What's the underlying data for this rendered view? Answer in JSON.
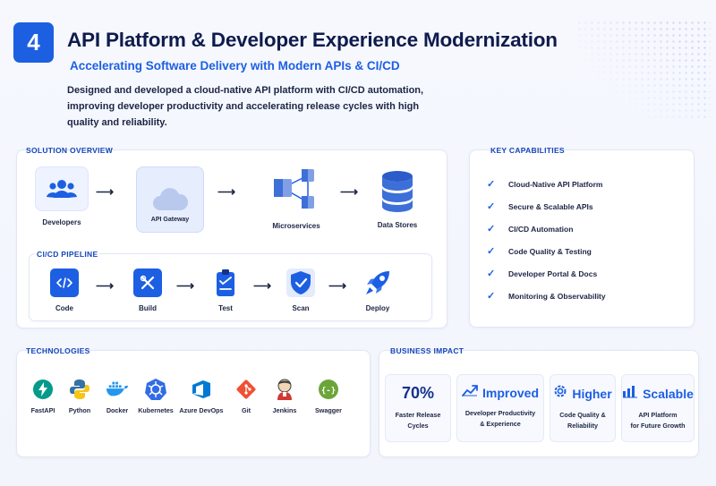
{
  "header": {
    "badge_number": "4",
    "title": "API Platform & Developer Experience Modernization",
    "subtitle": "Accelerating Software Delivery with Modern APIs & CI/CD",
    "description": "Designed and developed a cloud-native API platform with CI/CD automation, improving developer productivity and accelerating release cycles with high quality and reliability."
  },
  "solution_overview": {
    "title": "SOLUTION OVERVIEW",
    "nodes": [
      {
        "label": "Developers",
        "icon": "users-icon"
      },
      {
        "label": "API Gateway",
        "icon": "cloud-icon"
      },
      {
        "label": "Microservices",
        "icon": "cubes-icon"
      },
      {
        "label": "Data Stores",
        "icon": "database-icon"
      }
    ]
  },
  "pipeline": {
    "title": "CI/CD PIPELINE",
    "steps": [
      {
        "label": "Code",
        "icon": "code-icon"
      },
      {
        "label": "Build",
        "icon": "tools-icon"
      },
      {
        "label": "Test",
        "icon": "clipboard-check-icon"
      },
      {
        "label": "Scan",
        "icon": "shield-check-icon"
      },
      {
        "label": "Deploy",
        "icon": "rocket-icon"
      }
    ]
  },
  "capabilities": {
    "title": "KEY CAPABILITIES",
    "items": [
      "Cloud-Native API Platform",
      "Secure & Scalable APIs",
      "CI/CD Automation",
      "Code Quality & Testing",
      "Developer Portal & Docs",
      "Monitoring & Observability"
    ]
  },
  "technologies": {
    "title": "TECHNOLOGIES",
    "items": [
      {
        "label": "FastAPI",
        "icon": "fastapi-icon",
        "color": "#059b8a"
      },
      {
        "label": "Python",
        "icon": "python-icon",
        "color": "#3572a5"
      },
      {
        "label": "Docker",
        "icon": "docker-icon",
        "color": "#2496ed"
      },
      {
        "label": "Kubernetes",
        "icon": "kubernetes-icon",
        "color": "#326ce5"
      },
      {
        "label": "Azure DevOps",
        "icon": "azure-devops-icon",
        "color": "#0078d4"
      },
      {
        "label": "Git",
        "icon": "git-icon",
        "color": "#f05033"
      },
      {
        "label": "Jenkins",
        "icon": "jenkins-icon",
        "color": "#d33833"
      },
      {
        "label": "Swagger",
        "icon": "swagger-icon",
        "color": "#6ba539"
      }
    ]
  },
  "business_impact": {
    "title": "BUSINESS IMPACT",
    "cards": [
      {
        "value": "70%",
        "line1": "Faster Release",
        "line2": "Cycles",
        "icon": ""
      },
      {
        "value": "Improved",
        "line1": "Developer Productivity",
        "line2": "& Experience",
        "icon": "trend-up-icon"
      },
      {
        "value": "Higher",
        "line1": "Code Quality &",
        "line2": "Reliability",
        "icon": "gear-icon"
      },
      {
        "value": "Scalable",
        "line1": "API Platform",
        "line2": "for Future Growth",
        "icon": "bar-chart-icon"
      }
    ]
  }
}
